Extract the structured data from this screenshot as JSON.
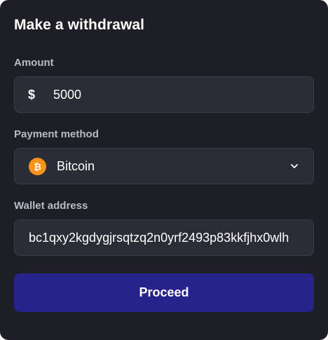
{
  "title": "Make a withdrawal",
  "amount": {
    "label": "Amount",
    "currency_symbol": "$",
    "value": "5000"
  },
  "payment_method": {
    "label": "Payment method",
    "selected": "Bitcoin",
    "icon": "bitcoin-icon",
    "icon_color": "#f7931a"
  },
  "wallet": {
    "label": "Wallet address",
    "value": "bc1qxy2kgdygjrsqtzq2n0yrf2493p83kkfjhx0wlh"
  },
  "proceed": {
    "label": "Proceed",
    "color": "#26238a"
  }
}
